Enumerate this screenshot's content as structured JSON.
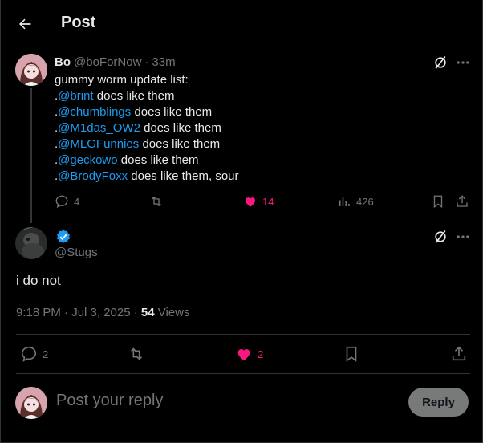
{
  "header": {
    "title": "Post"
  },
  "parent_post": {
    "name": "Bo",
    "handle": "@boForNow",
    "sep": "·",
    "time": "33m",
    "lines": [
      {
        "prefix": "",
        "mention": "",
        "text": "gummy worm update list:"
      },
      {
        "prefix": ".",
        "mention": "@brint",
        "text": " does like them"
      },
      {
        "prefix": ".",
        "mention": "@chumblings",
        "text": " does like them"
      },
      {
        "prefix": ".",
        "mention": "@M1das_OW2",
        "text": " does like them"
      },
      {
        "prefix": ".",
        "mention": "@MLGFunnies",
        "text": " does like them"
      },
      {
        "prefix": ".",
        "mention": "@geckowo",
        "text": " does like them"
      },
      {
        "prefix": ".",
        "mention": "@BrodyFoxx",
        "text": " does like them, sour"
      }
    ],
    "stats": {
      "replies": "4",
      "reposts": "",
      "likes": "14",
      "views": "426"
    }
  },
  "main_post": {
    "handle": "@Stugs",
    "text": "i do not",
    "time": "9:18 PM · Jul 3, 2025 · ",
    "views_count": "54",
    "views_label": " Views",
    "stats": {
      "replies": "2",
      "reposts": "",
      "likes": "2"
    }
  },
  "reply_box": {
    "placeholder": "Post your reply",
    "button": "Reply"
  },
  "colors": {
    "accent": "#1d9bf0",
    "like": "#f91880",
    "muted": "#71767b",
    "background": "#000000"
  }
}
